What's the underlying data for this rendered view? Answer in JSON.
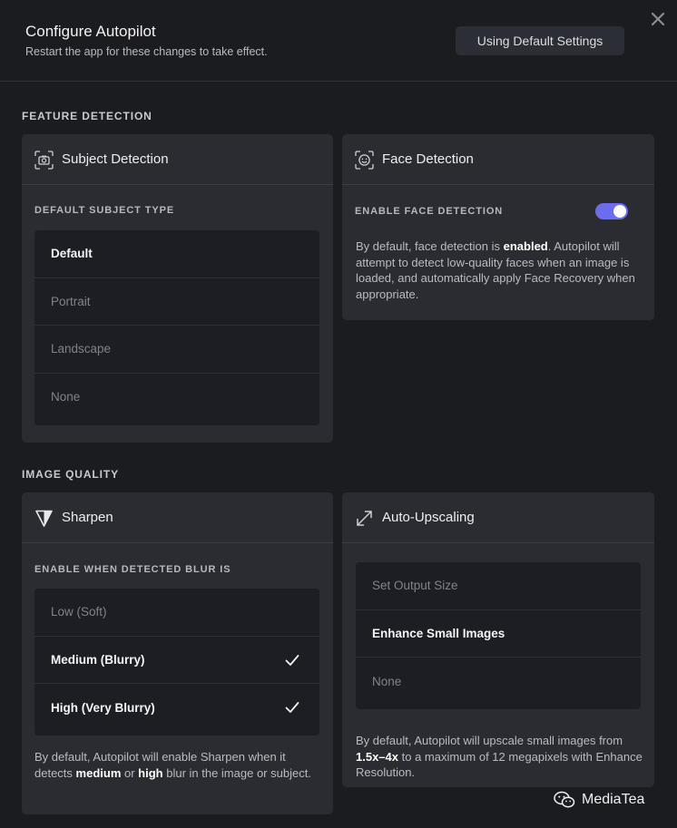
{
  "header": {
    "title": "Configure Autopilot",
    "subtitle": "Restart the app for these changes to take effect.",
    "default_button": "Using Default Settings",
    "close_icon": "close-icon"
  },
  "sections": {
    "feature_detection": "FEATURE DETECTION",
    "image_quality": "IMAGE QUALITY"
  },
  "subject_detection": {
    "title": "Subject Detection",
    "icon": "camera-frame-icon",
    "field_label": "DEFAULT SUBJECT TYPE",
    "options": [
      {
        "label": "Default",
        "selected": true
      },
      {
        "label": "Portrait",
        "selected": false
      },
      {
        "label": "Landscape",
        "selected": false
      },
      {
        "label": "None",
        "selected": false
      }
    ]
  },
  "face_detection": {
    "title": "Face Detection",
    "icon": "face-icon",
    "field_label": "ENABLE FACE DETECTION",
    "toggle_on": true,
    "desc_pre": "By default, face detection is ",
    "desc_bold": "enabled",
    "desc_post": ". Autopilot will attempt to detect low-quality faces when an image is loaded, and automatically apply Face Recovery when appropriate."
  },
  "sharpen": {
    "title": "Sharpen",
    "icon": "sharpen-triangle-icon",
    "field_label": "ENABLE WHEN DETECTED BLUR IS",
    "options": [
      {
        "label": "Low (Soft)",
        "selected": false
      },
      {
        "label": "Medium (Blurry)",
        "selected": true
      },
      {
        "label": "High (Very Blurry)",
        "selected": true
      }
    ],
    "desc_1": "By default, Autopilot will enable Sharpen when it detects ",
    "desc_b1": "medium",
    "desc_2": " or ",
    "desc_b2": "high",
    "desc_3": " blur in the image or subject."
  },
  "upscaling": {
    "title": "Auto-Upscaling",
    "icon": "expand-arrows-icon",
    "options": [
      {
        "label": "Set Output Size",
        "selected": false
      },
      {
        "label": "Enhance Small Images",
        "selected": true
      },
      {
        "label": "None",
        "selected": false
      }
    ],
    "desc_1": "By default, Autopilot will upscale small images from ",
    "desc_b1": "1.5x–4x",
    "desc_2": " to a maximum of 12 megapixels with Enhance Resolution."
  },
  "watermark": {
    "text": "MediaTea",
    "icon": "wechat-icon"
  },
  "colors": {
    "accent": "#6b6cf0",
    "background": "#1b1c20",
    "card": "#2a2c31"
  }
}
